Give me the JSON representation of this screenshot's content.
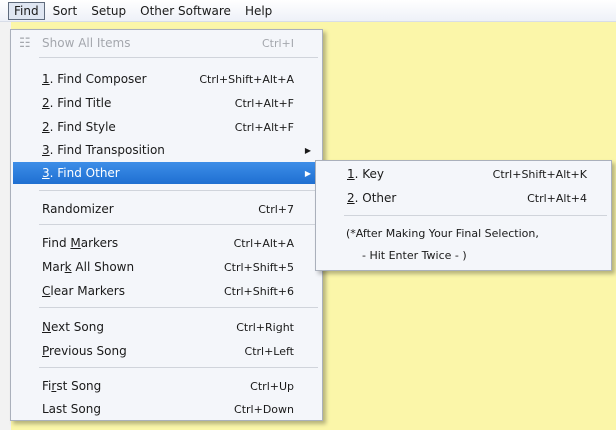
{
  "menubar": {
    "items": [
      "Find",
      "Sort",
      "Setup",
      "Other Software",
      "Help"
    ]
  },
  "find_menu": {
    "show_all_items": {
      "label": "Show All Items",
      "shortcut": "Ctrl+I"
    },
    "find_composer": {
      "mn": "1",
      "label": ". Find Composer",
      "shortcut": "Ctrl+Shift+Alt+A"
    },
    "find_title": {
      "mn": "2",
      "label": ". Find Title",
      "shortcut": "Ctrl+Alt+F"
    },
    "find_style": {
      "mn": "2",
      "label": ". Find Style",
      "shortcut": "Ctrl+Alt+F"
    },
    "find_transposition": {
      "mn": "3",
      "label": ". Find Transposition"
    },
    "find_other": {
      "mn": "3",
      "label": ". Find Other"
    },
    "randomizer": {
      "label": "Randomizer",
      "shortcut": "Ctrl+7"
    },
    "find_markers": {
      "pre": "Find ",
      "mn": "M",
      "post": "arkers",
      "shortcut": "Ctrl+Alt+A"
    },
    "mark_all_shown": {
      "pre": "Mar",
      "mn": "k",
      "post": " All Shown",
      "shortcut": "Ctrl+Shift+5"
    },
    "clear_markers": {
      "mn": "C",
      "post": "lear Markers",
      "shortcut": "Ctrl+Shift+6"
    },
    "next_song": {
      "mn": "N",
      "post": "ext Song",
      "shortcut": "Ctrl+Right"
    },
    "previous_song": {
      "mn": "P",
      "post": "revious Song",
      "shortcut": "Ctrl+Left"
    },
    "first_song": {
      "pre": "Fi",
      "mn": "r",
      "post": "st Song",
      "shortcut": "Ctrl+Up"
    },
    "last_song": {
      "label": "Last Song",
      "shortcut": "Ctrl+Down"
    }
  },
  "find_other_submenu": {
    "key": {
      "mn": "1",
      "label": ". Key",
      "shortcut": "Ctrl+Shift+Alt+K"
    },
    "other": {
      "mn": "2",
      "label": ". Other",
      "shortcut": "Ctrl+Alt+4"
    },
    "note_line1": "(*After Making Your Final Selection,",
    "note_line2": "- Hit Enter Twice -    )"
  },
  "icons": {
    "show_all_items": "sliders-icon",
    "submenu_arrow": "triangle-right-icon"
  },
  "colors": {
    "background": "#fbf6a9",
    "highlight": "#2a7ddc",
    "menu_bg": "#f4f6fa"
  }
}
